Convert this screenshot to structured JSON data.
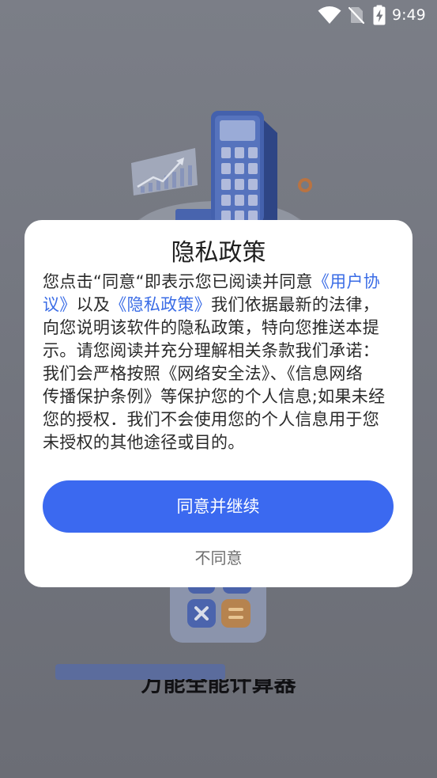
{
  "status_bar": {
    "time": "9:49",
    "icons": [
      "wifi-icon",
      "no-sim-icon",
      "battery-charging-icon"
    ]
  },
  "splash": {
    "app_name": "万能全能计算器",
    "loading_progress": 0.52
  },
  "dialog": {
    "title": "隐私政策",
    "body_lines": [
      [
        "您点击“同意“即表示您已阅读并同意",
        "《用户协"
      ],
      [
        "议》",
        "以及",
        "《隐私政策》",
        "我们依据最新的法律，"
      ],
      [
        "向您说明该软件的隐私政策，特向您推送本提"
      ],
      [
        "示。请您阅读并充分理解相关条款我们承诺："
      ],
      [
        "我们会严格按照《网络安全法》、《信息网络"
      ],
      [
        "传播保护条例》等保护您的个人信息;如果未经"
      ],
      [
        "您的授权．我们不会使用您的个人信息用于您"
      ],
      [
        "未授权的其他途径或目的。"
      ]
    ],
    "agree_button": "同意并继续",
    "disagree_button": "不同意"
  },
  "colors": {
    "accent": "#3b69f0",
    "link": "#3a6ce6"
  }
}
